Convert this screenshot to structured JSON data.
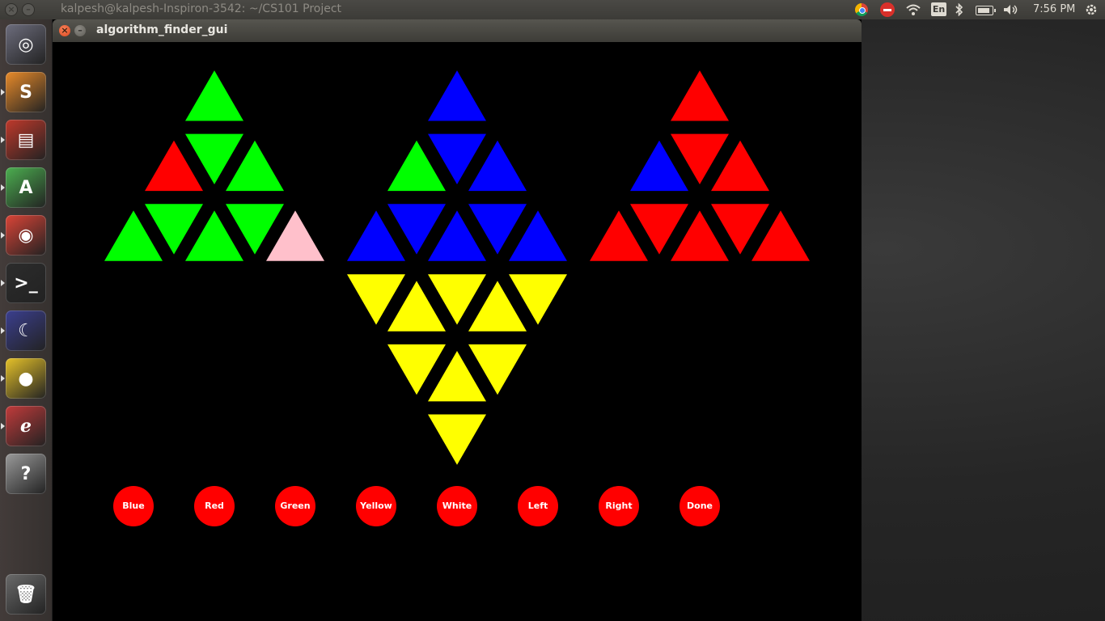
{
  "top_panel": {
    "title": "kalpesh@kalpesh-Inspiron-3542: ~/CS101 Project",
    "close_glyph": "×",
    "min_glyph": "–",
    "keyboard_layout": "En",
    "clock": "7:56 PM",
    "indicators": [
      "chrome-icon",
      "stop-icon",
      "wifi-icon",
      "keyboard-layout-icon",
      "bluetooth-icon",
      "battery-icon",
      "volume-icon",
      "settings-gear-icon"
    ]
  },
  "launcher": {
    "items": [
      {
        "name": "ubuntu-dash-icon",
        "glyph": "◎",
        "color": "#6d6d7d"
      },
      {
        "name": "sublime-text-icon",
        "glyph": "S",
        "color": "#e98b2a"
      },
      {
        "name": "file-manager-icon",
        "glyph": "▤",
        "color": "#c0392b"
      },
      {
        "name": "android-studio-icon",
        "glyph": "A",
        "color": "#4caf50"
      },
      {
        "name": "chrome-icon",
        "glyph": "◉",
        "color": "#db4437"
      },
      {
        "name": "terminal-icon",
        "glyph": ">_",
        "color": "#2c2c2c"
      },
      {
        "name": "stellarium-icon",
        "glyph": "☾",
        "color": "#3b3f8f"
      },
      {
        "name": "penguin-game-icon",
        "glyph": "●",
        "color": "#e6c229"
      },
      {
        "name": "pdf-viewer-icon",
        "glyph": "ℯ",
        "color": "#c23b3b"
      },
      {
        "name": "help-icon",
        "glyph": "?",
        "color": "#9a9a9a"
      },
      {
        "name": "trash-icon",
        "glyph": "🗑",
        "color": "#6a6a6a"
      }
    ]
  },
  "window": {
    "title": "algorithm_finder_gui",
    "close_glyph": "×",
    "min_glyph": "–"
  },
  "colors": {
    "green": "#00ff00",
    "red": "#ff0000",
    "blue": "#0000ff",
    "yellow": "#ffff00",
    "pink": "#ffc0cb",
    "button": "#ff0000"
  },
  "faces": {
    "left": [
      "green",
      "red",
      "green",
      "green",
      "green",
      "green",
      "green",
      "green",
      "pink"
    ],
    "center": [
      "blue",
      "green",
      "blue",
      "blue",
      "blue",
      "blue",
      "blue",
      "blue",
      "blue"
    ],
    "right": [
      "red",
      "blue",
      "red",
      "red",
      "red",
      "red",
      "red",
      "red",
      "red"
    ],
    "bottom": [
      "yellow",
      "yellow",
      "yellow",
      "yellow",
      "yellow",
      "yellow",
      "yellow",
      "yellow",
      "yellow"
    ]
  },
  "buttons": [
    "Blue",
    "Red",
    "Green",
    "Yellow",
    "White",
    "Left",
    "Right",
    "Done"
  ]
}
